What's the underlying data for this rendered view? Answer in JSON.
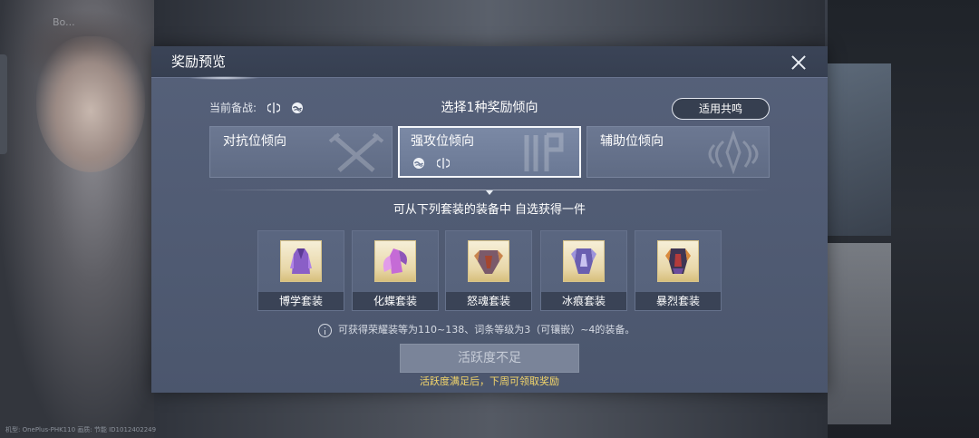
{
  "background": {
    "tag_text": "Bo...",
    "device_info": "机型: OnePlus-PHK110 画质: 节能 ID1012402249"
  },
  "dialog": {
    "title": "奖励预览",
    "current_label": "当前备战:",
    "select_title": "选择1种奖励倾向",
    "resonance_button": "适用共鸣",
    "tendencies": [
      {
        "label": "对抗位倾向",
        "selected": false,
        "art_icon": "crossed-swords-icon"
      },
      {
        "label": "强攻位倾向",
        "selected": true,
        "art_icon": "blade-emblem-icon"
      },
      {
        "label": "辅助位倾向",
        "selected": false,
        "art_icon": "lotus-emblem-icon"
      }
    ],
    "choose_text": "可从下列套装的装备中 自选获得一件",
    "sets": [
      {
        "label": "博学套装",
        "icon": "purple-robe-icon"
      },
      {
        "label": "化蝶套装",
        "icon": "butterfly-armor-icon"
      },
      {
        "label": "怒魂套装",
        "icon": "fury-armor-icon"
      },
      {
        "label": "冰痕套装",
        "icon": "ice-armor-icon"
      },
      {
        "label": "暴烈套装",
        "icon": "dark-armor-icon"
      }
    ],
    "info_text": "可获得荣耀装等为110~138、词条等级为3（可镶嵌）~4的装备。",
    "action_button": "活跃度不足",
    "hint": "活跃度满足后，下周可领取奖励"
  },
  "colors": {
    "dialog_bg": "#56617a",
    "header_bg": "#3b4457",
    "hint_yellow": "#f4d66b",
    "disabled_button": "#7a8499",
    "icon_frame_gold": "#d8c48a"
  }
}
